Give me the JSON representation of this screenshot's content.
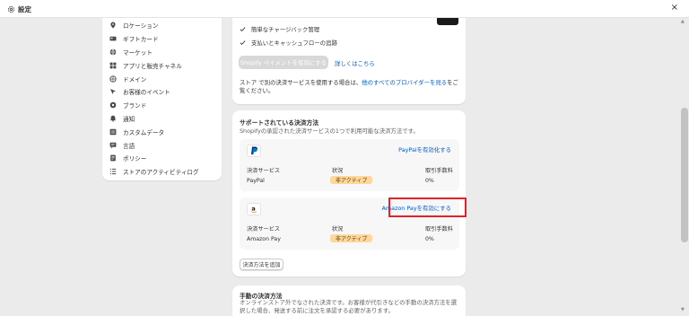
{
  "window": {
    "title": "設定",
    "icon": "gear-icon",
    "close_icon": "close-icon",
    "close_glyph": "×"
  },
  "sidebar": {
    "items": [
      {
        "label": "ロケーション",
        "icon": "location-pin-icon"
      },
      {
        "label": "ギフトカード",
        "icon": "gift-card-icon"
      },
      {
        "label": "マーケット",
        "icon": "globe-icon"
      },
      {
        "label": "アプリと販売チャネル",
        "icon": "apps-icon"
      },
      {
        "label": "ドメイン",
        "icon": "domain-globe-icon"
      },
      {
        "label": "お客様のイベント",
        "icon": "customer-events-icon"
      },
      {
        "label": "ブランド",
        "icon": "brand-icon"
      },
      {
        "label": "通知",
        "icon": "bell-icon"
      },
      {
        "label": "カスタムデータ",
        "icon": "custom-data-icon"
      },
      {
        "label": "言語",
        "icon": "language-icon"
      },
      {
        "label": "ポリシー",
        "icon": "policy-icon"
      },
      {
        "label": "ストアのアクティビティログ",
        "icon": "activity-log-icon"
      }
    ]
  },
  "shopify_payments": {
    "features": [
      "簡単なチャージバック管理",
      "支払いとキャッシュフローの追跡"
    ],
    "activate_button": "Shopify ペイメントを有効にする",
    "learn_more": "詳しくはこちら",
    "other_providers_prefix": "ストア で別の決済サービスを使用する場合は、",
    "other_providers_link": "他のすべてのプロバイダーを見る",
    "other_providers_suffix": "をご覧ください。"
  },
  "supported_methods": {
    "title": "サポートされている決済方法",
    "subtitle": "Shopifyの承認された決済サービスの1つで利用可能な決済方法です。",
    "column_headers": {
      "service": "決済サービス",
      "status": "状況",
      "fee": "取引手数料"
    },
    "providers": [
      {
        "name": "PayPal",
        "logo": "paypal-logo-icon",
        "enable_label": "PayPalを有効化する",
        "status": "非アクティブ",
        "fee": "0%"
      },
      {
        "name": "Amazon Pay",
        "logo": "amazon-logo-icon",
        "enable_label": "Amazon Payを有効にする",
        "status": "非アクティブ",
        "fee": "0%"
      }
    ],
    "add_button": "決済方法を追加"
  },
  "manual_methods": {
    "title": "手動の決済方法",
    "description": "オンラインストア外でなされた決済です。お客様が代引きなどの手動の決済方法を選択した場合、発送する前に注文を承認する必要があります。"
  },
  "colors": {
    "link": "#005bd3",
    "badge_bg": "#ffd79d",
    "highlight": "#e0232b"
  }
}
